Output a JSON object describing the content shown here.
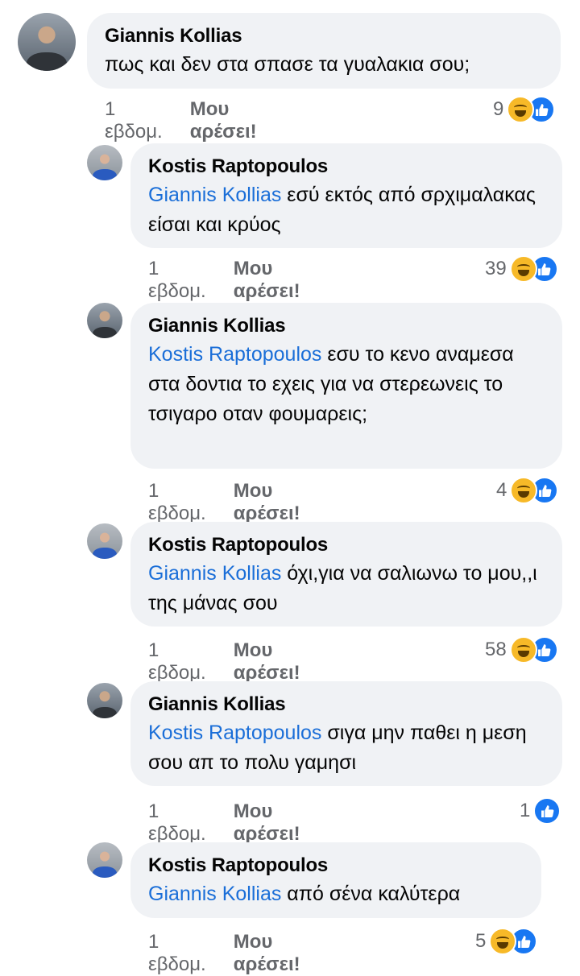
{
  "comments": [
    {
      "author": "Giannis Kollias",
      "mention": "",
      "text": "πως και δεν στα σπασε τα γυαλακια σου;",
      "time": "1 εβδομ.",
      "like_label": "Μου αρέσει!",
      "reaction_count": "9",
      "reactions": [
        "haha-icon",
        "like-icon"
      ]
    },
    {
      "author": "Kostis Raptopoulos",
      "mention": "Giannis Kollias",
      "text": " εσύ εκτός από σρχιμαλακας είσαι και κρύος",
      "time": "1 εβδομ.",
      "like_label": "Μου αρέσει!",
      "reaction_count": "39",
      "reactions": [
        "haha-icon",
        "like-icon"
      ]
    },
    {
      "author": "Giannis Kollias",
      "mention": "Kostis Raptopoulos",
      "text": " εσυ το κενο αναμεσα στα δοντια το εχεις για να στερεωνεις το τσιγαρο οταν φουμαρεις;",
      "time": "1 εβδομ.",
      "like_label": "Μου αρέσει!",
      "reaction_count": "4",
      "reactions": [
        "haha-icon",
        "like-icon"
      ]
    },
    {
      "author": "Kostis Raptopoulos",
      "mention": "Giannis Kollias",
      "text": " όχι,για να σαλιωνω το μου,,ι της μάνας σου",
      "time": "1 εβδομ.",
      "like_label": "Μου αρέσει!",
      "reaction_count": "58",
      "reactions": [
        "haha-icon",
        "like-icon"
      ]
    },
    {
      "author": "Giannis Kollias",
      "mention": "Kostis Raptopoulos",
      "text": " σιγα μην παθει η μεση σου απ το πολυ γαμησι",
      "time": "1 εβδομ.",
      "like_label": "Μου αρέσει!",
      "reaction_count": "1",
      "reactions": [
        "like-icon"
      ]
    },
    {
      "author": "Kostis Raptopoulos",
      "mention": "Giannis Kollias",
      "text": " από σένα καλύτερα",
      "time": "1 εβδομ.",
      "like_label": "Μου αρέσει!",
      "reaction_count": "5",
      "reactions": [
        "haha-icon",
        "like-icon"
      ]
    }
  ],
  "colors": {
    "bubble": "#f0f2f5",
    "mention": "#1a6ed8",
    "meta": "#65676b",
    "like": "#1877f2",
    "haha": "#f7b928"
  }
}
